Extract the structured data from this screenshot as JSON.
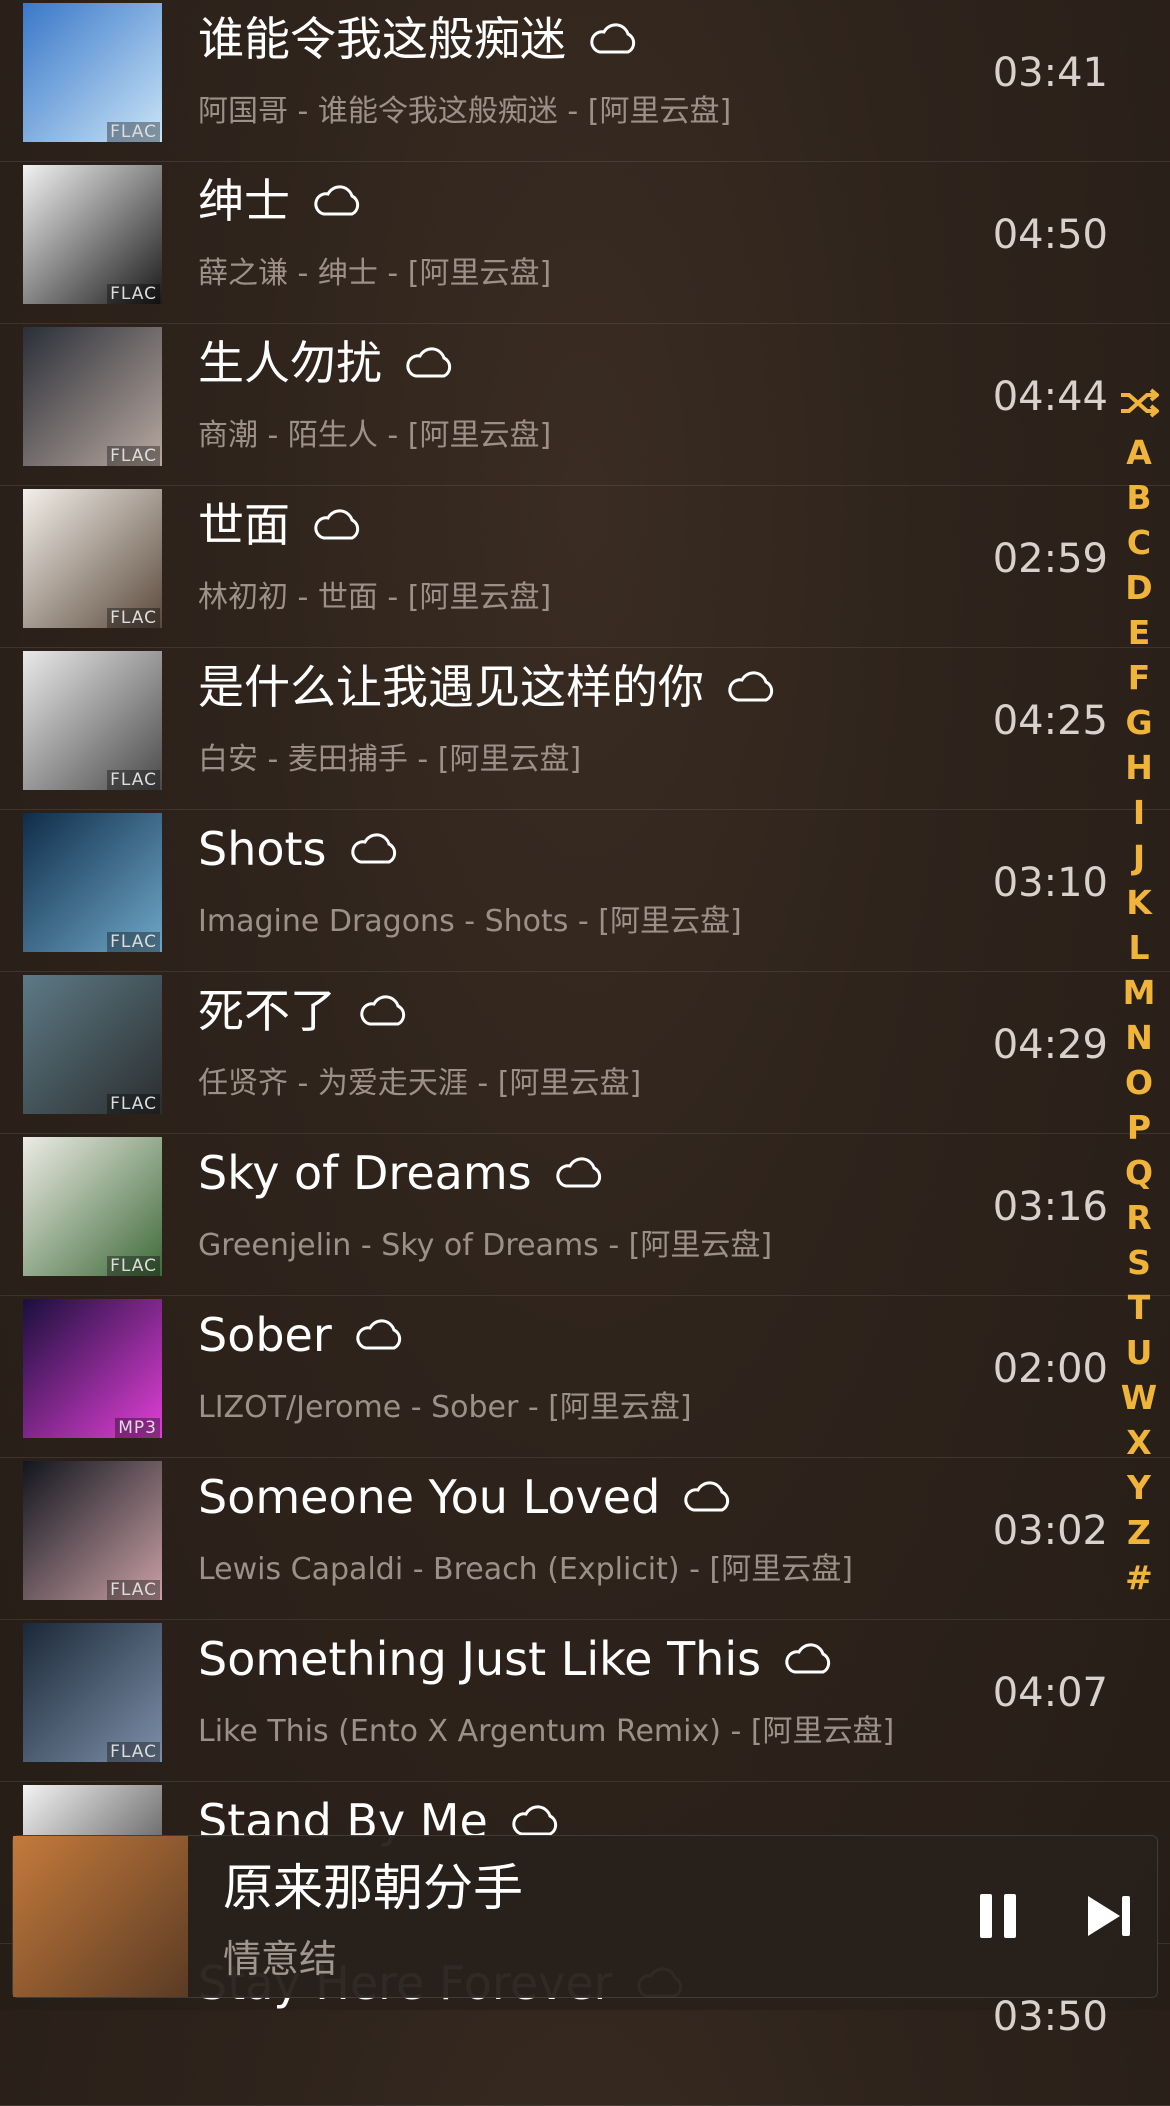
{
  "songs": [
    {
      "title": "谁能令我这般痴迷",
      "subtitle": "阿国哥 - 谁能令我这般痴迷 - [阿里云盘]",
      "duration": "03:41",
      "format": "FLAC",
      "cover_colors": [
        "#3a78c9",
        "#c9e4f7"
      ]
    },
    {
      "title": "绅士",
      "subtitle": "薛之谦 - 绅士 - [阿里云盘]",
      "duration": "04:50",
      "format": "FLAC",
      "cover_colors": [
        "#f2f2f2",
        "#1a1a1a"
      ]
    },
    {
      "title": "生人勿扰",
      "subtitle": "商潮 - 陌生人 - [阿里云盘]",
      "duration": "04:44",
      "format": "FLAC",
      "cover_colors": [
        "#2a2f38",
        "#b9a8a0"
      ]
    },
    {
      "title": "世面",
      "subtitle": "林初初 - 世面 - [阿里云盘]",
      "duration": "02:59",
      "format": "FLAC",
      "cover_colors": [
        "#f3efe9",
        "#5b4a3c"
      ]
    },
    {
      "title": "是什么让我遇见这样的你",
      "subtitle": "白安 - 麦田捕手 - [阿里云盘]",
      "duration": "04:25",
      "format": "FLAC",
      "cover_colors": [
        "#e9e9e9",
        "#4a4a4a"
      ]
    },
    {
      "title": "Shots",
      "subtitle": "Imagine Dragons - Shots - [阿里云盘]",
      "duration": "03:10",
      "format": "FLAC",
      "cover_colors": [
        "#0f2d4a",
        "#6fa7c7"
      ]
    },
    {
      "title": "死不了",
      "subtitle": "任贤齐 - 为爱走天涯 - [阿里云盘]",
      "duration": "04:29",
      "format": "FLAC",
      "cover_colors": [
        "#5d7a86",
        "#2b2e2f"
      ]
    },
    {
      "title": "Sky of Dreams",
      "subtitle": "Greenjelin - Sky of Dreams - [阿里云盘]",
      "duration": "03:16",
      "format": "FLAC",
      "cover_colors": [
        "#ecebe4",
        "#3f6b3a"
      ]
    },
    {
      "title": "Sober",
      "subtitle": "LIZOT/Jerome - Sober - [阿里云盘]",
      "duration": "02:00",
      "format": "MP3",
      "cover_colors": [
        "#1a0f3c",
        "#e13fd6"
      ]
    },
    {
      "title": "Someone You Loved",
      "subtitle": "Lewis Capaldi - Breach (Explicit) - [阿里云盘]",
      "duration": "03:02",
      "format": "FLAC",
      "cover_colors": [
        "#12151d",
        "#c9a0a6"
      ]
    },
    {
      "title": "Something Just Like This",
      "subtitle": "Like This (Ento X Argentum Remix) - [阿里云盘]",
      "duration": "04:07",
      "format": "FLAC",
      "cover_colors": [
        "#1b2838",
        "#7d90a9"
      ]
    },
    {
      "title": "Stand By Me",
      "subtitle": "",
      "duration": "",
      "format": "",
      "cover_colors": [
        "#f3f3f3",
        "#333333"
      ]
    }
  ],
  "partial_next_title": "Stay Here Forever",
  "partial_next_duration": "03:50",
  "index_letters": [
    "A",
    "B",
    "C",
    "D",
    "E",
    "F",
    "G",
    "H",
    "I",
    "J",
    "K",
    "L",
    "M",
    "N",
    "O",
    "P",
    "Q",
    "R",
    "S",
    "T",
    "U",
    "W",
    "X",
    "Y",
    "Z",
    "#"
  ],
  "accent_color": "#f0b43a",
  "now_playing": {
    "title": "原来那朝分手",
    "artist": "情意结",
    "cover_colors": [
      "#c47a3b",
      "#5a3b24"
    ]
  }
}
